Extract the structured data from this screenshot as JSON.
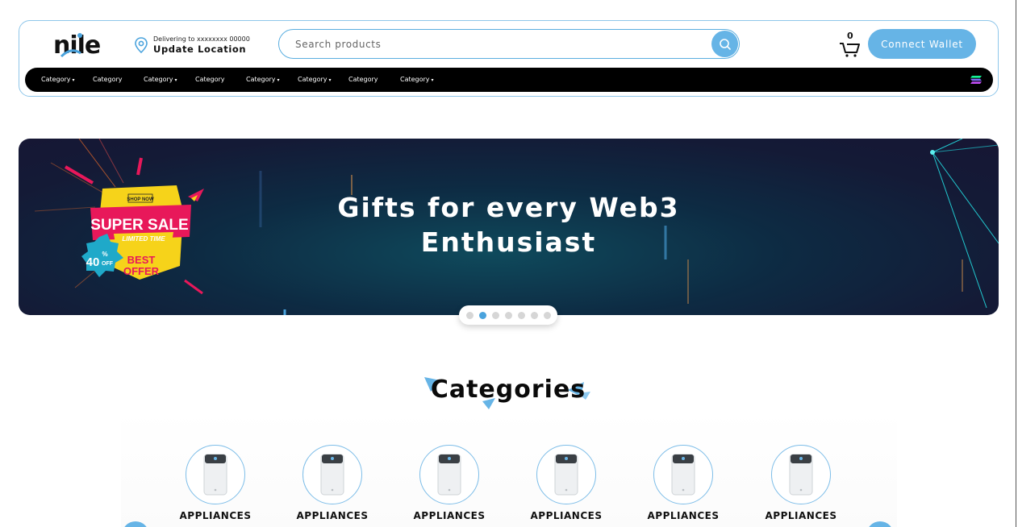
{
  "header": {
    "logo_text": "nile",
    "location": {
      "small": "Delivering to xxxxxxxx 00000",
      "big": "Update Location"
    },
    "search": {
      "placeholder": "Search products",
      "value": ""
    },
    "cart": {
      "count": "0"
    },
    "wallet_button": "Connect Wallet"
  },
  "nav": {
    "items": [
      {
        "label": "Category",
        "dropdown": true
      },
      {
        "label": "Category",
        "dropdown": false
      },
      {
        "label": "Category",
        "dropdown": true
      },
      {
        "label": "Category",
        "dropdown": false
      },
      {
        "label": "Category",
        "dropdown": true
      },
      {
        "label": "Category",
        "dropdown": true
      },
      {
        "label": "Category",
        "dropdown": false
      },
      {
        "label": "Category",
        "dropdown": true
      }
    ],
    "caret": "▾"
  },
  "banner": {
    "title_line1": "Gifts for every Web3",
    "title_line2": "Enthusiast",
    "sale_badge": {
      "shop_now": "SHOP NOW",
      "super_sale": "SUPER SALE",
      "limited": "LIMITED TIME",
      "percent": "40",
      "percent_sign": "%",
      "off": "OFF",
      "best": "BEST",
      "offer": "OFFER"
    },
    "slides_total": 7,
    "active_slide": 2
  },
  "categories": {
    "heading": "Categories",
    "items": [
      {
        "label": "APPLIANCES",
        "icon": "air-purifier-icon"
      },
      {
        "label": "APPLIANCES",
        "icon": "air-purifier-icon"
      },
      {
        "label": "APPLIANCES",
        "icon": "air-purifier-icon"
      },
      {
        "label": "APPLIANCES",
        "icon": "air-purifier-icon"
      },
      {
        "label": "APPLIANCES",
        "icon": "air-purifier-icon"
      },
      {
        "label": "APPLIANCES",
        "icon": "air-purifier-icon"
      }
    ]
  },
  "colors": {
    "accent": "#66b4e6",
    "nav_bg": "#000000",
    "banner_bg": "#0d2b43",
    "sale_pink": "#e8185a",
    "sale_yellow": "#f6d31a"
  }
}
